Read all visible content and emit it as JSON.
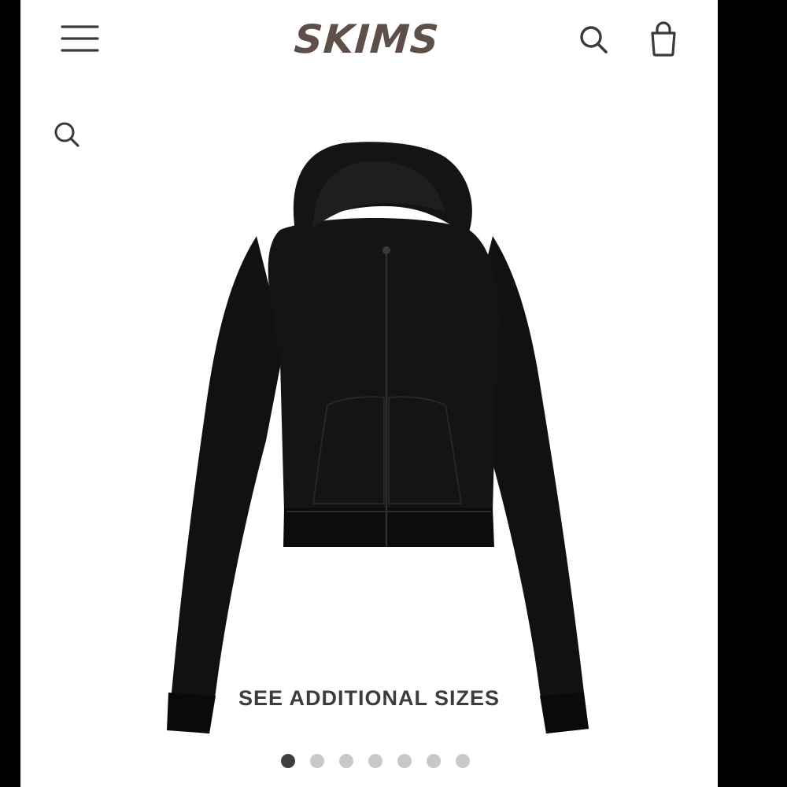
{
  "header": {
    "brand_logo": "SKIMS",
    "menu_icon": "hamburger-menu-icon",
    "search_icon": "search-icon",
    "bag_icon": "shopping-bag-icon"
  },
  "gallery": {
    "search_icon": "search-icon",
    "product_image": "black-cropped-zip-hoodie",
    "see_sizes_label": "SEE ADDITIONAL SIZES",
    "dots": {
      "count": 7,
      "active_index": 0
    }
  },
  "colors": {
    "logo": "#5e5048",
    "icons": "#3a3a3a",
    "active_dot": "#3f3f3f",
    "inactive_dot": "#c8c8c8",
    "frame": "#000000",
    "background": "#ffffff"
  }
}
